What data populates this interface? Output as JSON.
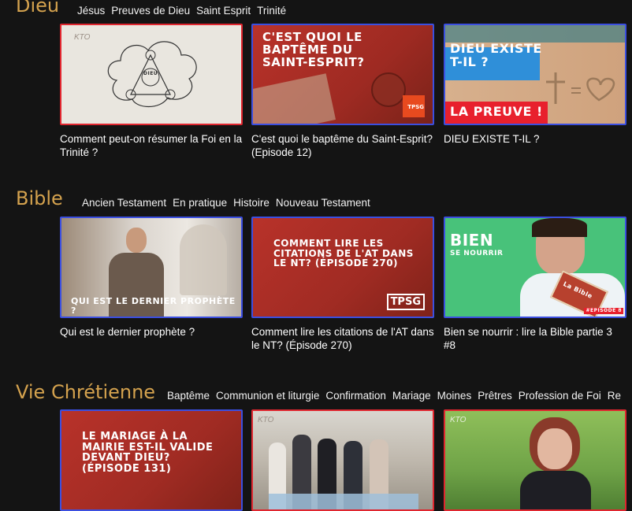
{
  "sections": [
    {
      "title": "Dieu",
      "tags": [
        "Jésus",
        "Preuves de Dieu",
        "Saint Esprit",
        "Trinité"
      ],
      "cards": [
        {
          "caption": "Comment peut-on résumer la Foi en la Trinité ?",
          "thumb_label": "DIEU",
          "logo": "KTO"
        },
        {
          "caption": "C'est quoi le baptême du Saint-Esprit? (Episode 12)",
          "thumb_text": "C'EST QUOI LE BAPTÊME DU SAINT-ESPRIT?",
          "logo": "TPSG"
        },
        {
          "caption": "DIEU EXISTE T-IL ?",
          "thumb_text": "DIEU EXISTE T-IL ?",
          "thumb_text2": "LA PREUVE !"
        }
      ]
    },
    {
      "title": "Bible",
      "tags": [
        "Ancien Testament",
        "En pratique",
        "Histoire",
        "Nouveau Testament"
      ],
      "cards": [
        {
          "caption": "Qui est le dernier prophète ?",
          "thumb_text": "QUI EST LE DERNIER PROPHÈTE ?"
        },
        {
          "caption": "Comment lire les citations de l'AT dans le NT? (Épisode 270)",
          "thumb_text": "COMMENT LIRE LES CITATIONS DE L'AT DANS LE NT? (ÉPISODE 270)",
          "logo": "TPSG"
        },
        {
          "caption": "Bien se nourrir : lire la Bible partie 3 #8",
          "thumb_text": "BIEN",
          "thumb_text2": "SE NOURRIR",
          "thumb_text3": "#EPISODE 8",
          "thumb_text4": "La Bible"
        }
      ]
    },
    {
      "title": "Vie Chrétienne",
      "tags": [
        "Baptême",
        "Communion et liturgie",
        "Confirmation",
        "Mariage",
        "Moines",
        "Prêtres",
        "Profession de Foi",
        "Re"
      ],
      "cards": [
        {
          "thumb_text": "LE MARIAGE À LA MAIRIE EST-IL VALIDE DEVANT DIEU? (ÉPISODE 131)"
        },
        {
          "logo": "KTO"
        },
        {
          "logo": "KTO"
        }
      ]
    }
  ]
}
